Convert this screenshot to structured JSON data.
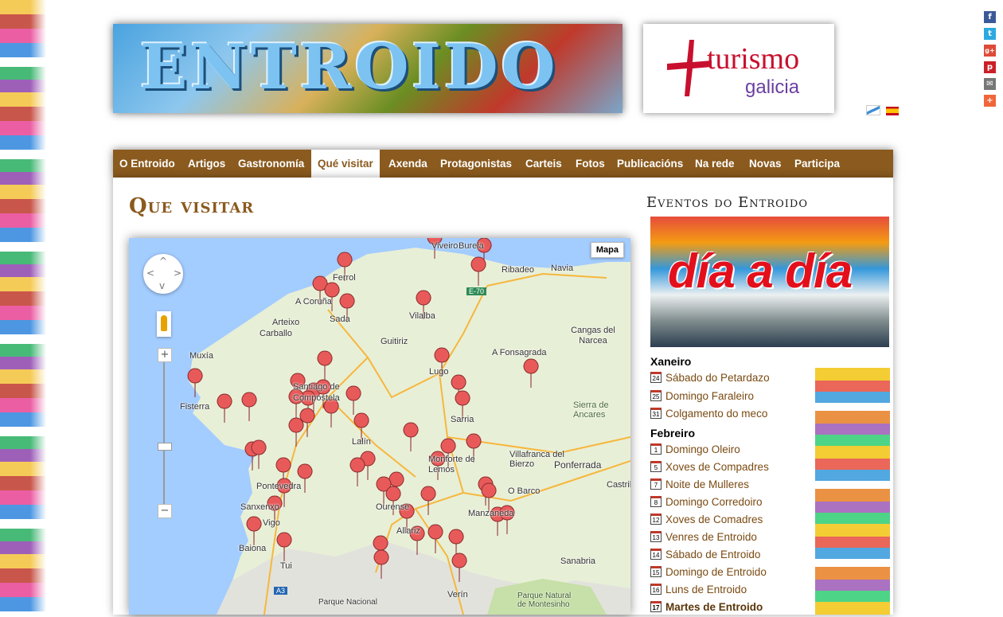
{
  "header": {
    "banner_text": "ENTROIDO",
    "turismo_main": "turismo",
    "turismo_sub": "galicia"
  },
  "nav": {
    "items": [
      {
        "label": "O Entroido"
      },
      {
        "label": "Artigos"
      },
      {
        "label": "Gastronomía"
      },
      {
        "label": "Qué visitar"
      },
      {
        "label": "Axenda"
      },
      {
        "label": "Protagonistas"
      },
      {
        "label": "Carteis"
      },
      {
        "label": "Fotos"
      },
      {
        "label": "Publicacións"
      },
      {
        "label": "Na rede"
      },
      {
        "label": "Novas"
      },
      {
        "label": "Participa"
      }
    ],
    "active": "Qué visitar"
  },
  "main": {
    "title": "Que visitar"
  },
  "map": {
    "type_button": "Mapa",
    "labels": [
      "Viveiro",
      "Burela",
      "Ribadeo",
      "Navia",
      "Ferrol",
      "A Coruña",
      "Sada",
      "Arteixo",
      "Carballo",
      "Vilalba",
      "Muxía",
      "Guitiriz",
      "A Fonsagrada",
      "Cangas del Narcea",
      "Fisterra",
      "Santiago de Compostela",
      "Lugo",
      "Sarria",
      "Sierra de Ancares",
      "Lalín",
      "Monforte de Lemos",
      "Villafranca del Bierzo",
      "Ponferrada",
      "Pontevedra",
      "Sanxenxo",
      "Vigo",
      "Baiona",
      "Ourense",
      "O Barco",
      "Castrillo",
      "Manzaneda",
      "Allariz",
      "Sanabria",
      "Verín",
      "Tui",
      "Parque Nacional",
      "Parque Natural de Montesinho",
      "E-70",
      "A3"
    ]
  },
  "sidebar": {
    "title": "Eventos do Entroido",
    "banner_text": "día a día",
    "months": [
      {
        "name": "Xaneiro",
        "events": [
          {
            "day": "24",
            "label": "Sábado do Petardazo"
          },
          {
            "day": "25",
            "label": "Domingo Faraleiro"
          },
          {
            "day": "31",
            "label": "Colgamento do meco"
          }
        ]
      },
      {
        "name": "Febreiro",
        "events": [
          {
            "day": "1",
            "label": "Domingo Oleiro"
          },
          {
            "day": "5",
            "label": "Xoves de Compadres"
          },
          {
            "day": "7",
            "label": "Noite de Mulleres"
          },
          {
            "day": "8",
            "label": "Domingo Corredoiro"
          },
          {
            "day": "12",
            "label": "Xoves de Comadres"
          },
          {
            "day": "13",
            "label": "Venres de Entroido"
          },
          {
            "day": "14",
            "label": "Sábado de Entroido"
          },
          {
            "day": "15",
            "label": "Domingo de Entroido"
          },
          {
            "day": "16",
            "label": "Luns de Entroido"
          },
          {
            "day": "17",
            "label": "Martes de Entroido"
          }
        ]
      }
    ]
  },
  "colors": {
    "nav_bg": "#8a5a1e",
    "title": "#8a5a1e",
    "link": "#7a4a12",
    "marker": "#e85a5a"
  },
  "icons": [
    "facebook-icon",
    "twitter-icon",
    "google-plus-icon",
    "pinterest-icon",
    "email-icon",
    "more-icon",
    "galician-flag-icon",
    "spanish-flag-icon",
    "pan-control-icon",
    "pegman-icon",
    "map-marker-icon",
    "calendar-icon"
  ]
}
